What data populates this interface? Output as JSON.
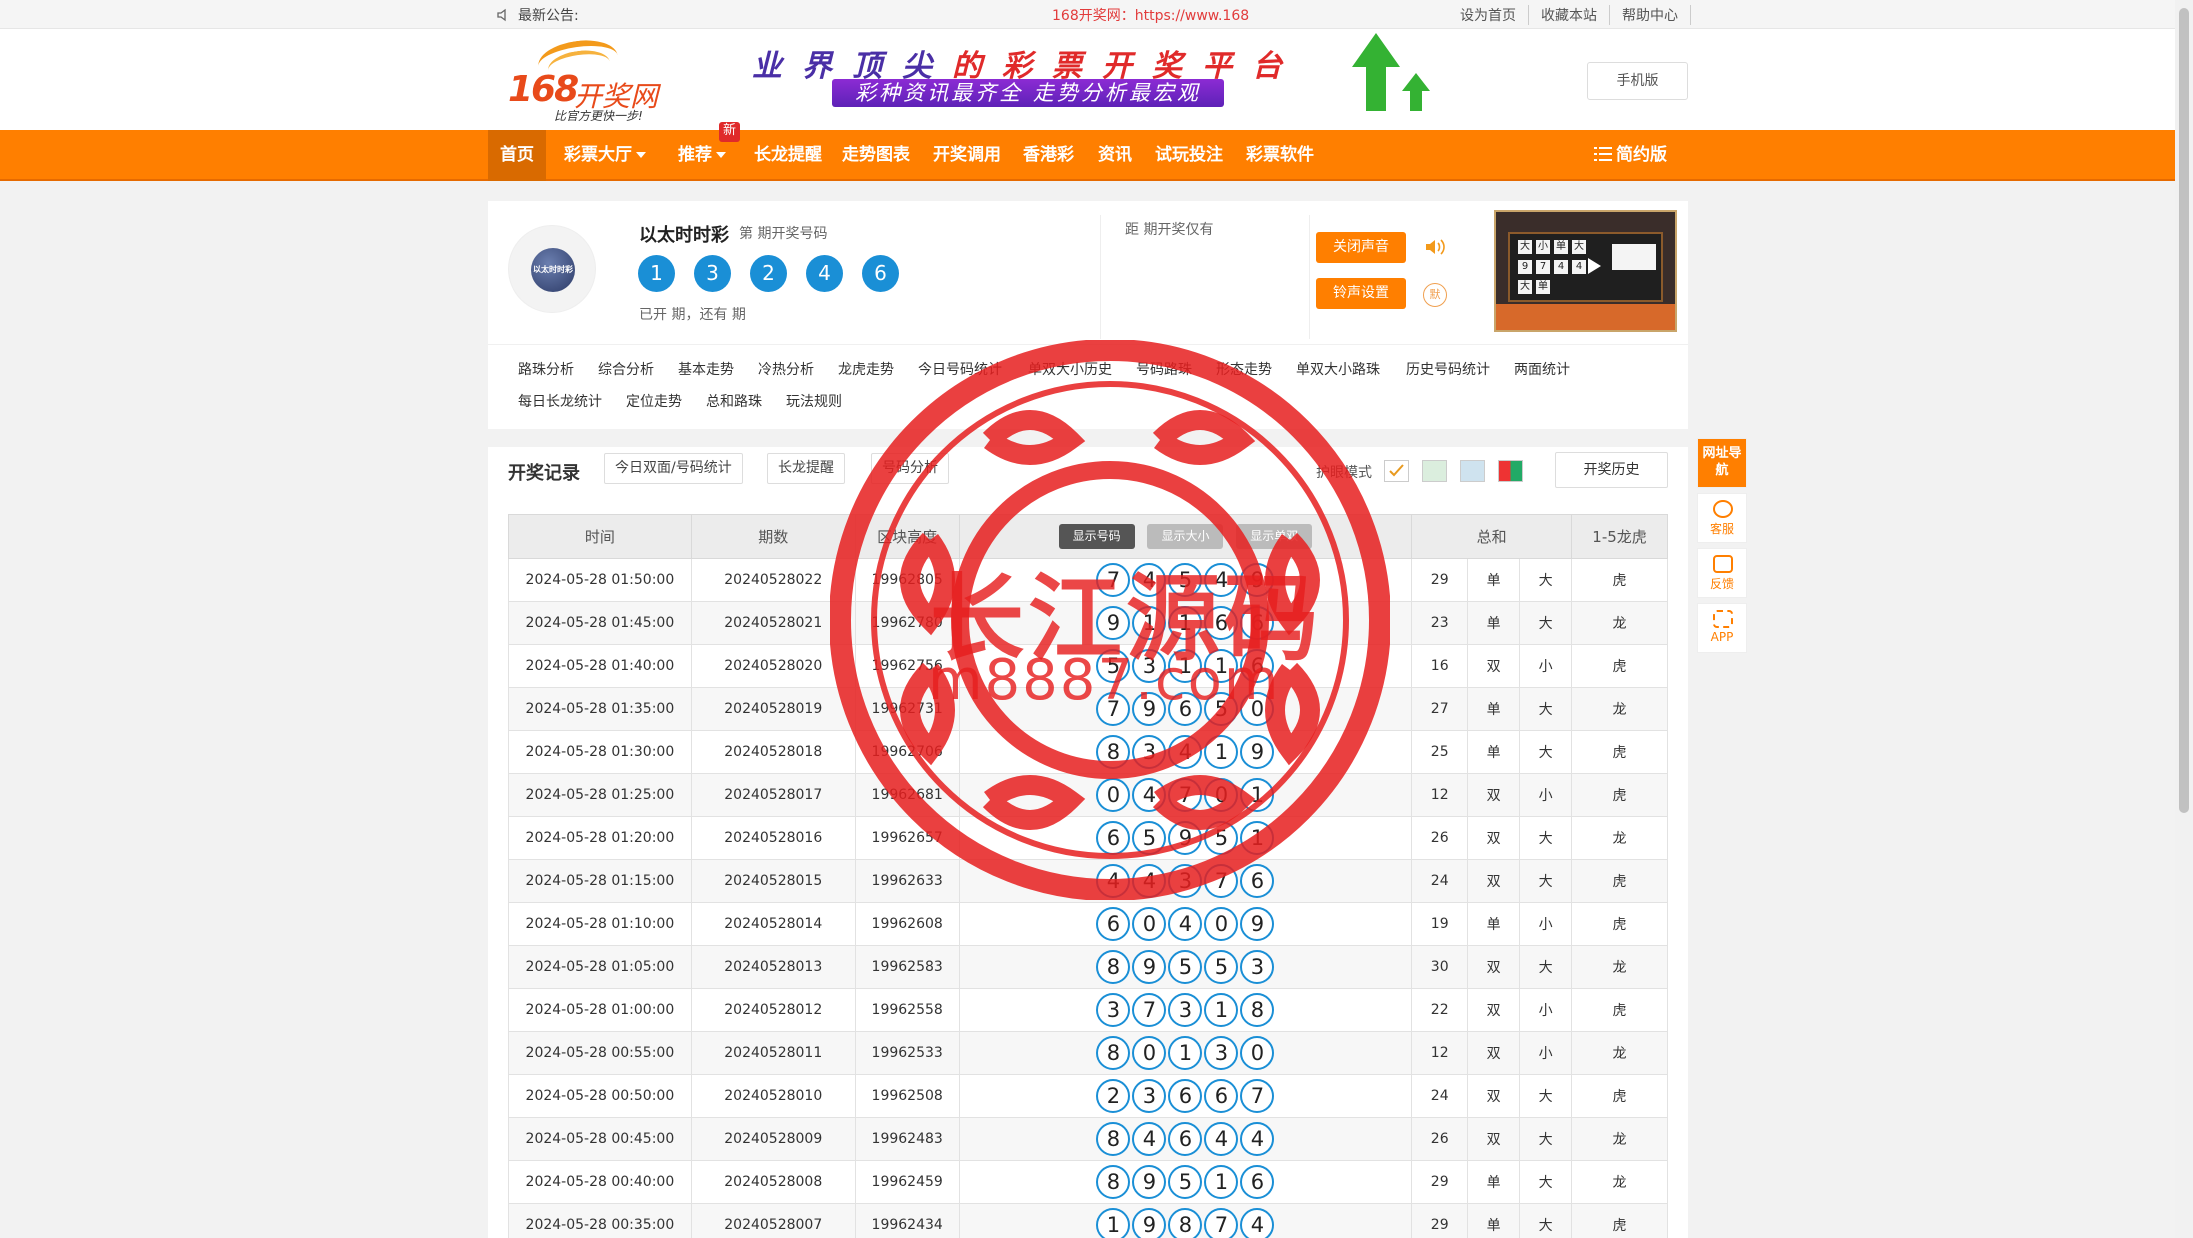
{
  "topbar": {
    "notice_label": "最新公告:",
    "marquee": "168开奖网：https://www.168",
    "links": [
      "设为首页",
      "收藏本站",
      "帮助中心"
    ]
  },
  "header": {
    "logo_num": "168",
    "logo_name": "开奖网",
    "logo_slogan": "比官方更快一步!",
    "banner_title_part1": "业界顶尖",
    "banner_title_part2": "的彩票开奖平台",
    "banner_sub": "彩种资讯最齐全 走势分析最宏观",
    "mobile_btn": "手机版"
  },
  "nav": {
    "items": [
      "首页",
      "彩票大厅",
      "推荐",
      "长龙提醒",
      "走势图表",
      "开奖调用",
      "香港彩",
      "资讯",
      "试玩投注",
      "彩票软件"
    ],
    "badge": "新",
    "simple": "简约版"
  },
  "lottery": {
    "logo_text": "以太时时彩",
    "name": "以太时时彩",
    "period_label": "第 期开奖号码",
    "balls": [
      "1",
      "3",
      "2",
      "4",
      "6"
    ],
    "status": "已开 期，还有 期",
    "countdown_label": "距 期开奖仅有",
    "close_sound_btn": "关闭声音",
    "ring_btn": "铃声设置",
    "ring_icon_text": "默"
  },
  "tabs": {
    "row1": [
      "路珠分析",
      "综合分析",
      "基本走势",
      "冷热分析",
      "龙虎走势",
      "今日号码统计",
      "单双大小历史",
      "号码路珠",
      "形态走势",
      "单双大小路珠",
      "历史号码统计",
      "两面统计"
    ],
    "row2": [
      "每日长龙统计",
      "定位走势",
      "总和路珠",
      "玩法规则"
    ]
  },
  "records": {
    "title": "开奖记录",
    "btns": [
      "今日双面/号码统计",
      "长龙提醒",
      "号码分析"
    ],
    "eye_mode": "护眼模式",
    "history_btn": "开奖历史",
    "headers": [
      "时间",
      "期数",
      "区块高度",
      "总和",
      "1-5龙虎"
    ],
    "toggles": [
      "显示号码",
      "显示大小",
      "显示单双"
    ],
    "rows": [
      {
        "time": "2024-05-28 01:50:00",
        "issue": "20240528022",
        "block": "19962805",
        "nums": [
          "7",
          "4",
          "5",
          "4",
          "9"
        ],
        "sum": "29",
        "oe": "单",
        "bs": "大",
        "lh": "虎"
      },
      {
        "time": "2024-05-28 01:45:00",
        "issue": "20240528021",
        "block": "19962780",
        "nums": [
          "9",
          "1",
          "1",
          "6",
          "6"
        ],
        "sum": "23",
        "oe": "单",
        "bs": "大",
        "lh": "龙"
      },
      {
        "time": "2024-05-28 01:40:00",
        "issue": "20240528020",
        "block": "19962756",
        "nums": [
          "5",
          "3",
          "1",
          "1",
          "6"
        ],
        "sum": "16",
        "oe": "双",
        "bs": "小",
        "lh": "虎"
      },
      {
        "time": "2024-05-28 01:35:00",
        "issue": "20240528019",
        "block": "19962731",
        "nums": [
          "7",
          "9",
          "6",
          "5",
          "0"
        ],
        "sum": "27",
        "oe": "单",
        "bs": "大",
        "lh": "龙"
      },
      {
        "time": "2024-05-28 01:30:00",
        "issue": "20240528018",
        "block": "19962706",
        "nums": [
          "8",
          "3",
          "4",
          "1",
          "9"
        ],
        "sum": "25",
        "oe": "单",
        "bs": "大",
        "lh": "虎"
      },
      {
        "time": "2024-05-28 01:25:00",
        "issue": "20240528017",
        "block": "19962681",
        "nums": [
          "0",
          "4",
          "7",
          "0",
          "1"
        ],
        "sum": "12",
        "oe": "双",
        "bs": "小",
        "lh": "虎"
      },
      {
        "time": "2024-05-28 01:20:00",
        "issue": "20240528016",
        "block": "19962657",
        "nums": [
          "6",
          "5",
          "9",
          "5",
          "1"
        ],
        "sum": "26",
        "oe": "双",
        "bs": "大",
        "lh": "龙"
      },
      {
        "time": "2024-05-28 01:15:00",
        "issue": "20240528015",
        "block": "19962633",
        "nums": [
          "4",
          "4",
          "3",
          "7",
          "6"
        ],
        "sum": "24",
        "oe": "双",
        "bs": "大",
        "lh": "虎"
      },
      {
        "time": "2024-05-28 01:10:00",
        "issue": "20240528014",
        "block": "19962608",
        "nums": [
          "6",
          "0",
          "4",
          "0",
          "9"
        ],
        "sum": "19",
        "oe": "单",
        "bs": "小",
        "lh": "虎"
      },
      {
        "time": "2024-05-28 01:05:00",
        "issue": "20240528013",
        "block": "19962583",
        "nums": [
          "8",
          "9",
          "5",
          "5",
          "3"
        ],
        "sum": "30",
        "oe": "双",
        "bs": "大",
        "lh": "龙"
      },
      {
        "time": "2024-05-28 01:00:00",
        "issue": "20240528012",
        "block": "19962558",
        "nums": [
          "3",
          "7",
          "3",
          "1",
          "8"
        ],
        "sum": "22",
        "oe": "双",
        "bs": "小",
        "lh": "虎"
      },
      {
        "time": "2024-05-28 00:55:00",
        "issue": "20240528011",
        "block": "19962533",
        "nums": [
          "8",
          "0",
          "1",
          "3",
          "0"
        ],
        "sum": "12",
        "oe": "双",
        "bs": "小",
        "lh": "龙"
      },
      {
        "time": "2024-05-28 00:50:00",
        "issue": "20240528010",
        "block": "19962508",
        "nums": [
          "2",
          "3",
          "6",
          "6",
          "7"
        ],
        "sum": "24",
        "oe": "双",
        "bs": "大",
        "lh": "虎"
      },
      {
        "time": "2024-05-28 00:45:00",
        "issue": "20240528009",
        "block": "19962483",
        "nums": [
          "8",
          "4",
          "6",
          "4",
          "4"
        ],
        "sum": "26",
        "oe": "双",
        "bs": "大",
        "lh": "龙"
      },
      {
        "time": "2024-05-28 00:40:00",
        "issue": "20240528008",
        "block": "19962459",
        "nums": [
          "8",
          "9",
          "5",
          "1",
          "6"
        ],
        "sum": "29",
        "oe": "单",
        "bs": "大",
        "lh": "龙"
      },
      {
        "time": "2024-05-28 00:35:00",
        "issue": "20240528007",
        "block": "19962434",
        "nums": [
          "1",
          "9",
          "8",
          "7",
          "4"
        ],
        "sum": "29",
        "oe": "单",
        "bs": "大",
        "lh": "虎"
      }
    ]
  },
  "side": [
    "网址导航",
    "客服",
    "反馈",
    "APP"
  ],
  "watermark": {
    "line1": "长江源码",
    "line2": "m8887.com"
  },
  "colors": {
    "brand_orange": "#ff7f00",
    "ball_blue": "#1a8fd6",
    "stamp_red": "#e61e1e"
  }
}
